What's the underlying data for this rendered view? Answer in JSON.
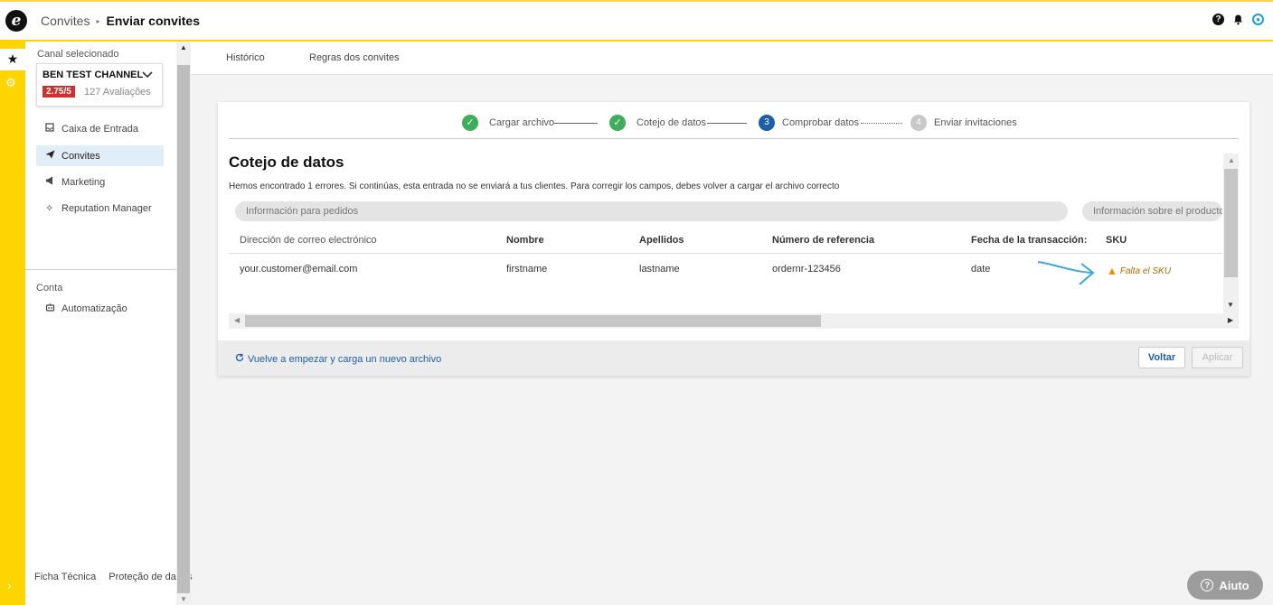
{
  "header": {
    "logo": "e",
    "breadcrumb_parent": "Convites",
    "breadcrumb_current": "Enviar convites",
    "icons": [
      "help-icon",
      "bell-icon",
      "user-icon"
    ]
  },
  "sidebar": {
    "caption": "Canal selecionado",
    "channel": {
      "name": "BEN TEST CHANNEL",
      "score": "2.75/5",
      "reviews": "127 Avaliações"
    },
    "items": [
      {
        "label": "Caixa de Entrada",
        "icon": "inbox-icon"
      },
      {
        "label": "Convites",
        "icon": "paper-plane-icon"
      },
      {
        "label": "Marketing",
        "icon": "megaphone-icon"
      },
      {
        "label": "Reputation Manager",
        "icon": "sparkle-icon"
      }
    ],
    "section_conta": "Conta",
    "conta_items": [
      {
        "label": "Automatização",
        "icon": "robot-icon"
      }
    ],
    "footer": {
      "ficha": "Ficha Técnica",
      "protecao": "Proteção de dados"
    }
  },
  "tabs": [
    "Histórico",
    "Regras dos convites"
  ],
  "stepper": {
    "steps": [
      {
        "label": "Cargar archivo",
        "state": "done"
      },
      {
        "label": "Cotejo de datos",
        "state": "done"
      },
      {
        "label": "Comprobar datos",
        "state": "current",
        "number": "3"
      },
      {
        "label": "Enviar invitaciones",
        "state": "pending",
        "number": "4"
      }
    ]
  },
  "main": {
    "title": "Cotejo de datos",
    "message": "Hemos encontrado 1 errores. Si continúas, esta entrada no se enviará a tus clientes. Para corregir los campos, debes volver a cargar el archivo correcto",
    "group_orders": "Información para pedidos",
    "group_product": "Información sobre el producto",
    "columns": [
      "Dirección de correo electrónico",
      "Nombre",
      "Apellidos",
      "Número de referencia",
      "Fecha de la transacción:",
      "SKU"
    ],
    "row": [
      "your.customer@email.com",
      "firstname",
      "lastname",
      "ordernr-123456",
      "date"
    ],
    "sku_warning": "Falta el SKU"
  },
  "footer": {
    "restart": "Vuelve a empezar y carga un nuevo archivo",
    "back": "Voltar",
    "apply": "Aplicar"
  },
  "help_button": "Aiuto",
  "colors": {
    "brand_yellow": "#ffd500",
    "success": "#3fae5a",
    "current_step": "#1c5fa8",
    "score_red": "#d32f2f",
    "link_blue": "#1c5fa8",
    "warning": "#f08c00"
  }
}
